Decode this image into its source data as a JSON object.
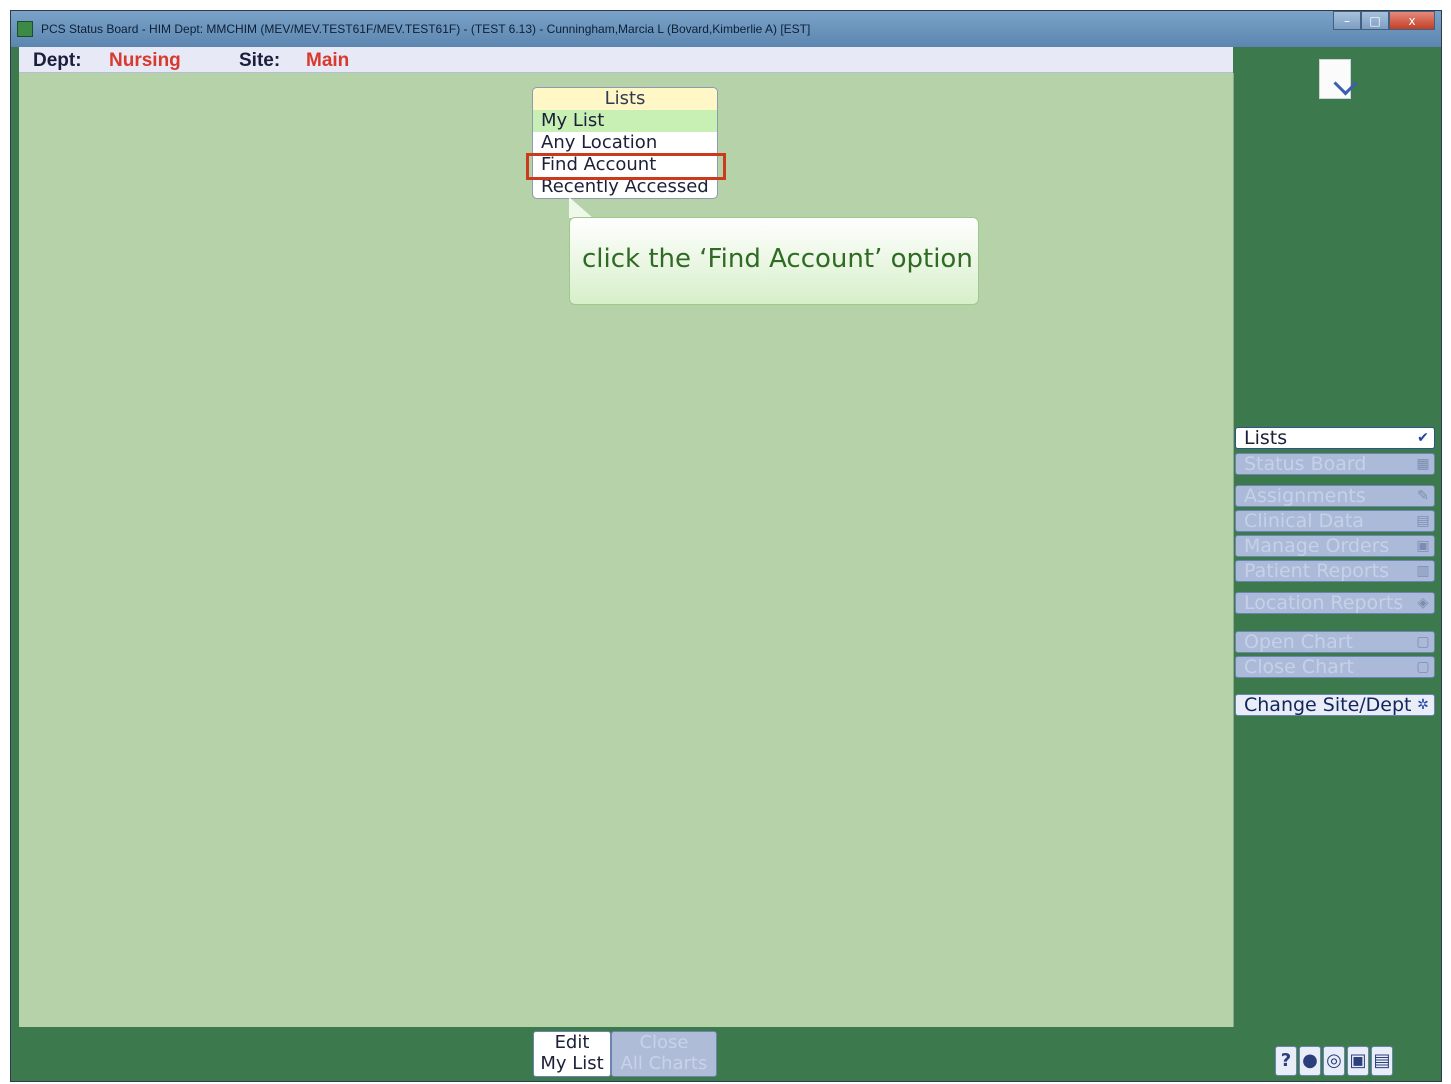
{
  "window": {
    "title": "PCS Status Board - HIM Dept: MMCHIM (MEV/MEV.TEST61F/MEV.TEST61F) - (TEST 6.13) - Cunningham,Marcia L (Bovard,Kimberlie A) [EST]",
    "controls": {
      "minimize": "–",
      "maximize": "□",
      "close": "x"
    }
  },
  "deptbar": {
    "dept_label": "Dept:",
    "dept_value": "Nursing",
    "site_label": "Site:",
    "site_value": "Main"
  },
  "lists_popup": {
    "header": "Lists",
    "items": [
      {
        "label": "My List"
      },
      {
        "label": "Any Location"
      },
      {
        "label": "Find Account"
      },
      {
        "label": "Recently Accessed"
      }
    ]
  },
  "callout": {
    "text": "click the ‘Find Account’ option"
  },
  "sidebar": {
    "buttons": [
      {
        "label": "Lists",
        "icon": "checklist-icon"
      },
      {
        "label": "Status Board",
        "icon": "grid-icon"
      },
      {
        "label": "Assignments",
        "icon": "pencil-icon"
      },
      {
        "label": "Clinical Data",
        "icon": "document-icon"
      },
      {
        "label": "Manage Orders",
        "icon": "order-icon"
      },
      {
        "label": "Patient Reports",
        "icon": "report-icon"
      },
      {
        "label": "Location Reports",
        "icon": "location-report-icon"
      },
      {
        "label": "Open Chart",
        "icon": "open-chart-icon"
      },
      {
        "label": "Close Chart",
        "icon": "close-chart-icon"
      },
      {
        "label": "Change Site/Dept",
        "icon": "gear-icon"
      }
    ]
  },
  "bottom": {
    "edit_line1": "Edit",
    "edit_line2": "My List",
    "close_line1": "Close",
    "close_line2": "All Charts"
  },
  "utility_icons": [
    "?",
    "●",
    "◎",
    "▣",
    "▤"
  ]
}
